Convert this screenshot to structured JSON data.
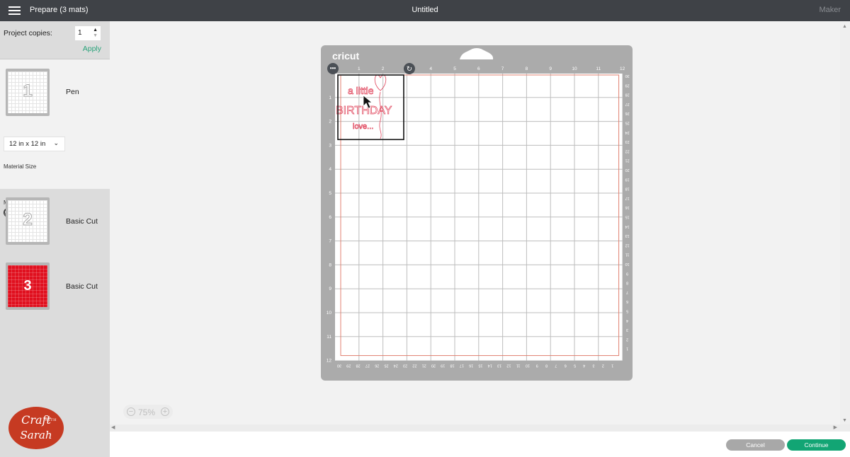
{
  "header": {
    "menu_icon": "hamburger-icon",
    "title": "Prepare (3 mats)",
    "project_name": "Untitled",
    "machine": "Maker"
  },
  "sidebar": {
    "copies_label": "Project copies:",
    "copies_value": "1",
    "apply_label": "Apply",
    "mats": [
      {
        "number": "1",
        "label": "Pen",
        "color": "#ffffff"
      },
      {
        "number": "2",
        "label": "Basic Cut",
        "color": "#ffffff"
      },
      {
        "number": "3",
        "label": "Basic Cut",
        "color": "#e0101f"
      }
    ],
    "material_size_label": "Material Size",
    "material_size_value": "12 in x 12 in",
    "mirror_label": "Mirror",
    "mirror_on": false
  },
  "mat": {
    "brand": "cricut",
    "top_ruler": [
      "1",
      "2",
      "3",
      "4",
      "5",
      "6",
      "7",
      "8",
      "9",
      "10",
      "11",
      "12"
    ],
    "left_ruler": [
      "1",
      "2",
      "3",
      "4",
      "5",
      "6",
      "7",
      "8",
      "9",
      "10",
      "11",
      "12"
    ],
    "right_ruler_cm": [
      "30",
      "29",
      "28",
      "27",
      "26",
      "25",
      "24",
      "23",
      "22",
      "21",
      "20",
      "19",
      "18",
      "17",
      "16",
      "15",
      "14",
      "13",
      "12",
      "11",
      "10",
      "9",
      "8",
      "7",
      "6",
      "5",
      "4",
      "3",
      "2",
      "1"
    ],
    "bottom_ruler_cm": [
      "30",
      "29",
      "28",
      "27",
      "26",
      "25",
      "24",
      "23",
      "22",
      "21",
      "20",
      "19",
      "18",
      "17",
      "16",
      "15",
      "14",
      "13",
      "12",
      "11",
      "10",
      "9",
      "8",
      "7",
      "6",
      "5",
      "4",
      "3",
      "2",
      "1"
    ],
    "design_lines": [
      "a little",
      "BIRTHDAY",
      "love..."
    ],
    "design_color": "#e0455c"
  },
  "canvas": {
    "zoom_level": "75%"
  },
  "footer": {
    "cancel_label": "Cancel",
    "continue_label": "Continue"
  },
  "branding": {
    "line1": "Craft",
    "with": "WITH",
    "line2": "Sarah"
  }
}
